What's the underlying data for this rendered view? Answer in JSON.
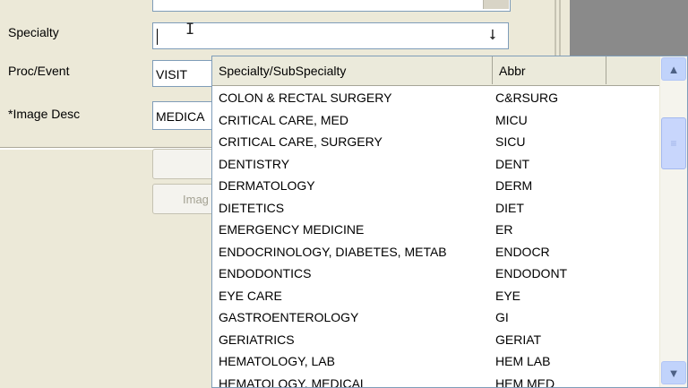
{
  "labels": {
    "specialty": "Specialty",
    "proc_event": "Proc/Event",
    "image_desc": "*Image Desc"
  },
  "fields": {
    "specialty_value": "",
    "proc_event_value": "VISIT",
    "image_desc_value": "MEDICA"
  },
  "buttons": {
    "image_button_label": "Imag"
  },
  "icons": {
    "dropdown_arrow": "down-arrow-icon",
    "scroll_up": "chevron-up-icon",
    "scroll_down": "chevron-down-icon",
    "text_cursor": "i-beam-cursor-icon"
  },
  "dropdown": {
    "columns": [
      "Specialty/SubSpecialty",
      "Abbr",
      ""
    ],
    "rows": [
      {
        "name": "COLON & RECTAL SURGERY",
        "abbr": "C&RSURG"
      },
      {
        "name": "CRITICAL CARE, MED",
        "abbr": "MICU"
      },
      {
        "name": "CRITICAL CARE, SURGERY",
        "abbr": "SICU"
      },
      {
        "name": "DENTISTRY",
        "abbr": "DENT"
      },
      {
        "name": "DERMATOLOGY",
        "abbr": "DERM"
      },
      {
        "name": "DIETETICS",
        "abbr": "DIET"
      },
      {
        "name": "EMERGENCY MEDICINE",
        "abbr": "ER"
      },
      {
        "name": "ENDOCRINOLOGY, DIABETES, METAB",
        "abbr": "ENDOCR"
      },
      {
        "name": "ENDODONTICS",
        "abbr": "ENDODONT"
      },
      {
        "name": "EYE CARE",
        "abbr": "EYE"
      },
      {
        "name": "GASTROENTEROLOGY",
        "abbr": "GI"
      },
      {
        "name": "GERIATRICS",
        "abbr": "GERIAT"
      },
      {
        "name": "HEMATOLOGY, LAB",
        "abbr": "HEM LAB"
      },
      {
        "name": "HEMATOLOGY, MEDICAL",
        "abbr": "HEM MED"
      }
    ]
  },
  "colors": {
    "window_bg": "#ece9d8",
    "field_border": "#7f9db9",
    "scrollbar_accent": "#c1d3fb"
  }
}
